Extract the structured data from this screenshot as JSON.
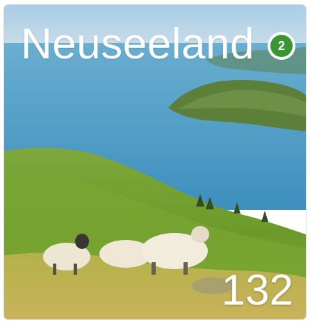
{
  "tile": {
    "title": "Neuseeland",
    "badge_count": "2",
    "item_count": "132",
    "image_description_icon": "landscape-photo-icon",
    "badge_color": "#3a9632"
  }
}
